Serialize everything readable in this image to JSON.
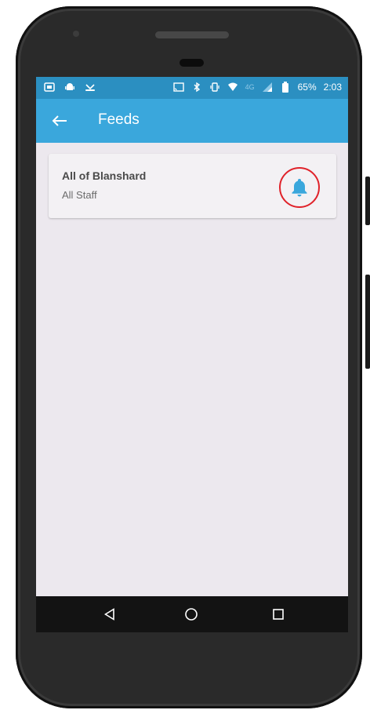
{
  "status_bar": {
    "battery_percent": "65%",
    "time": "2:03",
    "network_label": "4G"
  },
  "app_bar": {
    "title": "Feeds"
  },
  "feeds": [
    {
      "title": "All of Blanshard",
      "subtitle": "All Staff"
    }
  ],
  "colors": {
    "status_bar": "#2b8fc1",
    "app_bar": "#3aa7dc",
    "accent_bell": "#3aa7dc",
    "highlight_ring": "#e0222a",
    "screen_background": "#ece8ee"
  },
  "icons": {
    "back": "arrow-left-icon",
    "notifications": "bell-icon",
    "nav_back": "triangle-back-icon",
    "nav_home": "circle-home-icon",
    "nav_recents": "square-recents-icon"
  }
}
